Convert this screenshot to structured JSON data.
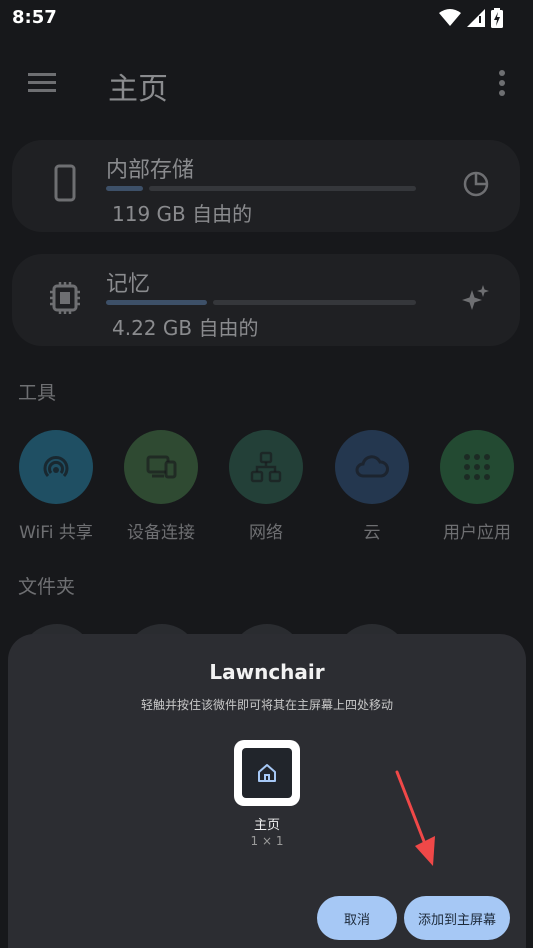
{
  "status_bar": {
    "time": "8:57"
  },
  "app_bar": {
    "title": "主页"
  },
  "storage_cards": [
    {
      "title": "内部存储",
      "subtitle": "119 GB 自由的",
      "usage_fraction": 0.12,
      "icon": "phone-icon",
      "action_icon": "pie-chart-icon"
    },
    {
      "title": "记忆",
      "subtitle": "4.22 GB 自由的",
      "usage_fraction": 0.34,
      "icon": "chip-icon",
      "action_icon": "sparkle-icon"
    }
  ],
  "tools": {
    "label": "工具",
    "items": [
      {
        "label": "WiFi 共享",
        "icon": "wifi-share-icon",
        "color": "#1f4f63"
      },
      {
        "label": "设备连接",
        "icon": "devices-icon",
        "color": "#2f4a32"
      },
      {
        "label": "网络",
        "icon": "network-icon",
        "color": "#234038"
      },
      {
        "label": "云",
        "icon": "cloud-icon",
        "color": "#24374f"
      },
      {
        "label": "用户应用",
        "icon": "apps-grid-icon",
        "color": "#234a32"
      }
    ]
  },
  "folders": {
    "label": "文件夹"
  },
  "widget_sheet": {
    "title": "Lawnchair",
    "description": "轻触并按住该微件即可将其在主屏幕上四处移动",
    "widget_name": "主页",
    "widget_size": "1 × 1",
    "widget_icon": "home-icon",
    "cancel_label": "取消",
    "add_label": "添加到主屏幕"
  },
  "colors": {
    "accent": "#a6c8f5",
    "annotation_arrow": "#f04848"
  }
}
